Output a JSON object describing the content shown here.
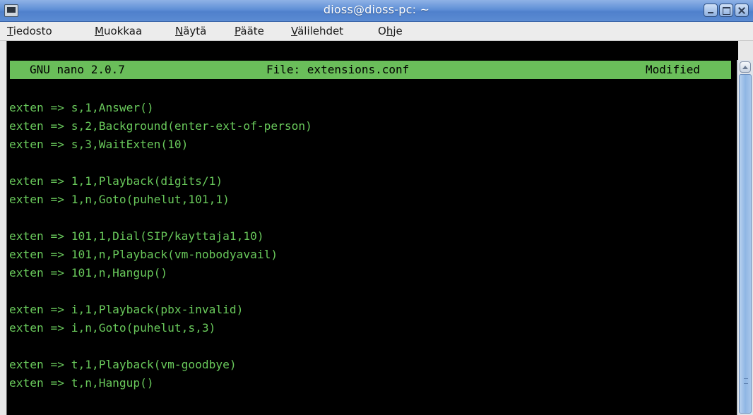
{
  "window": {
    "title": "dioss@dioss-pc: ~",
    "icon": "terminal-icon",
    "controls": [
      "minimize-icon",
      "maximize-icon",
      "close-icon"
    ]
  },
  "menubar": {
    "items": [
      {
        "accel": "T",
        "rest": "iedosto"
      },
      {
        "accel": "M",
        "rest": "uokkaa"
      },
      {
        "accel": "N",
        "rest": "äytä"
      },
      {
        "accel": "P",
        "rest": "ääte"
      },
      {
        "accel": "V",
        "rest": "älilehdet"
      },
      {
        "pre": "O",
        "accel": "h",
        "rest": "je"
      }
    ]
  },
  "nano": {
    "version": "GNU nano 2.0.7",
    "file": "File: extensions.conf",
    "status": "Modified"
  },
  "buffer": {
    "lines": [
      "",
      "exten => s,1,Answer()",
      "exten => s,2,Background(enter-ext-of-person)",
      "exten => s,3,WaitExten(10)",
      "",
      "exten => 1,1,Playback(digits/1)",
      "exten => 1,n,Goto(puhelut,101,1)",
      "",
      "exten => 101,1,Dial(SIP/kayttaja1,10)",
      "exten => 101,n,Playback(vm-nobodyavail)",
      "exten => 101,n,Hangup()",
      "",
      "exten => i,1,Playback(pbx-invalid)",
      "exten => i,n,Goto(puhelut,s,3)",
      "",
      "exten => t,1,Playback(vm-goodbye)",
      "exten => t,n,Hangup()"
    ]
  },
  "colors": {
    "terminal_bg": "#000000",
    "terminal_fg": "#69c95b",
    "header_bg": "#6abe5a"
  }
}
